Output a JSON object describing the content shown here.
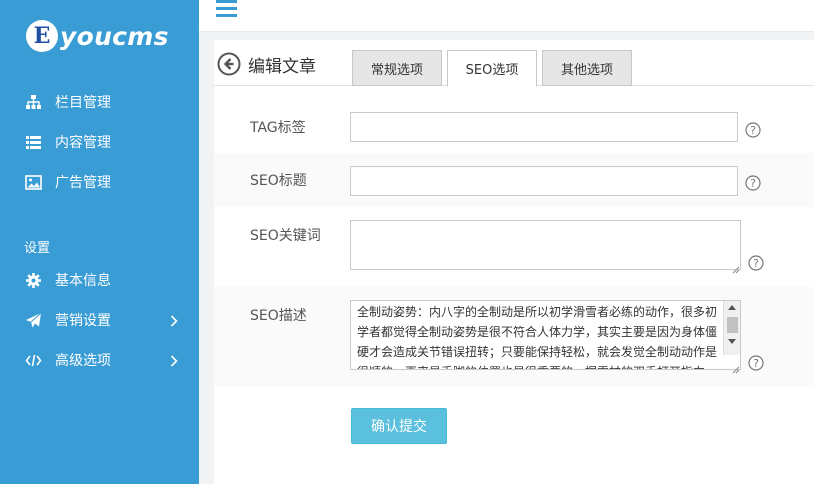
{
  "brand": {
    "badge": "E",
    "name": "youcms"
  },
  "sidebar": {
    "items": [
      {
        "label": "栏目管理",
        "icon": "sitemap-icon"
      },
      {
        "label": "内容管理",
        "icon": "list-icon"
      },
      {
        "label": "广告管理",
        "icon": "image-icon"
      }
    ],
    "section_title": "设置",
    "settings_items": [
      {
        "label": "基本信息",
        "icon": "gear-icon"
      },
      {
        "label": "营销设置",
        "icon": "send-icon",
        "expandable": true
      },
      {
        "label": "高级选项",
        "icon": "code-icon",
        "expandable": true
      }
    ]
  },
  "page": {
    "title": "编辑文章",
    "tabs": [
      {
        "label": "常规选项",
        "active": false
      },
      {
        "label": "SEO选项",
        "active": true
      },
      {
        "label": "其他选项",
        "active": false
      }
    ]
  },
  "form": {
    "tag_label": "TAG标签",
    "tag_value": "",
    "seo_title_label": "SEO标题",
    "seo_title_value": "",
    "seo_keywords_label": "SEO关键词",
    "seo_keywords_value": "",
    "seo_description_label": "SEO描述",
    "seo_description_value": "全制动姿势：内八字的全制动是所以初学滑雪者必练的动作，很多初学者都觉得全制动姿势是很不符合人体力学，其实主要是因为身体僵硬才会造成关节错误扭转；只要能保持轻松，就会发觉全制动动作是很顺的。再来是手脚的位置也是很重要的，握雪杖的双手打开指向",
    "help_symbol": "?"
  },
  "actions": {
    "submit_label": "确认提交"
  },
  "colors": {
    "sidebar": "#3a9cd4",
    "primary_button": "#5bc0de",
    "accent": "#3a9cd4"
  }
}
